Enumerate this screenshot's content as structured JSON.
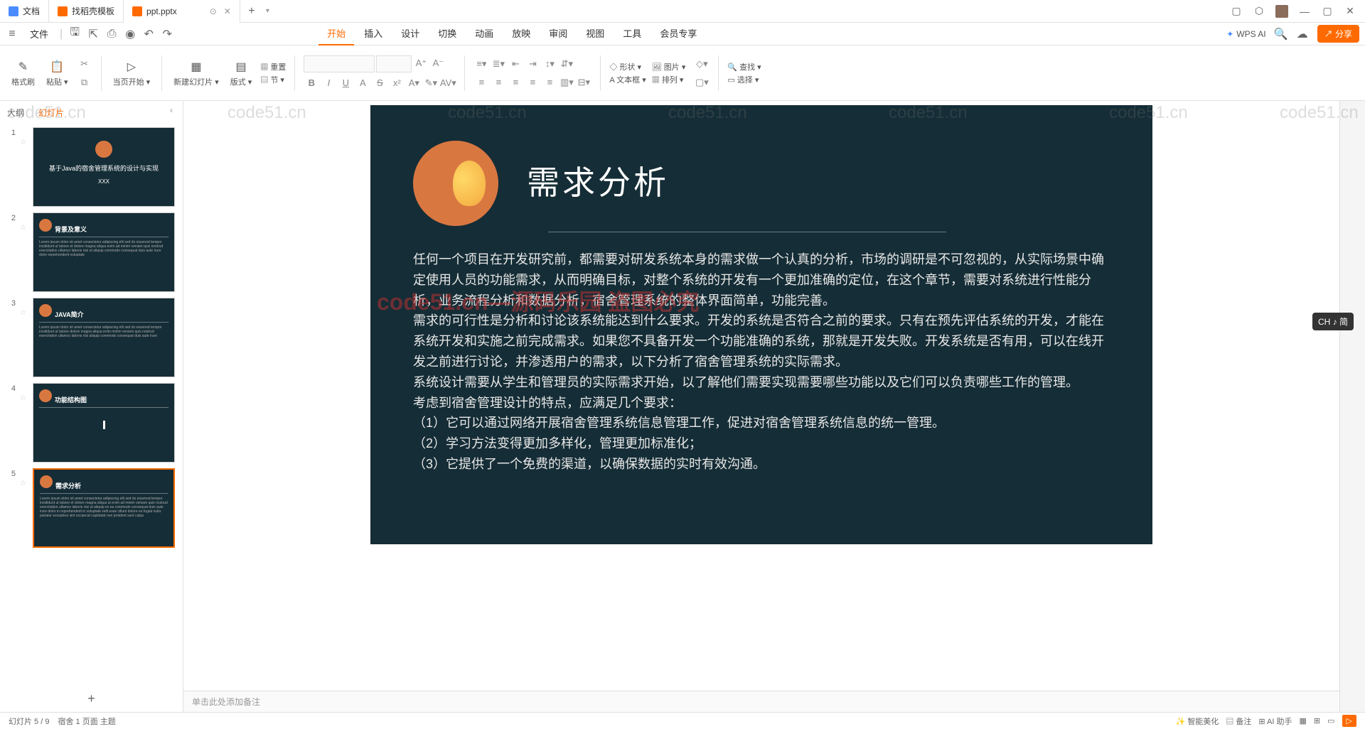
{
  "tabs": [
    {
      "label": "文档",
      "icon_color": "#4a8cff"
    },
    {
      "label": "找稻壳模板",
      "icon_color": "#ff6a00"
    },
    {
      "label": "ppt.pptx",
      "icon_color": "#ff6a00"
    }
  ],
  "menu": {
    "hamburger": "≡",
    "file": "文件",
    "tabs": [
      "开始",
      "插入",
      "设计",
      "切换",
      "动画",
      "放映",
      "审阅",
      "视图",
      "工具",
      "会员专享"
    ],
    "wps_ai": "WPS AI",
    "share": "分享"
  },
  "ribbon": {
    "format_painter": "格式刷",
    "paste": "粘贴",
    "start_from": "当页开始",
    "new_slide": "新建幻灯片",
    "layout": "版式",
    "section": "节",
    "reset": "重置",
    "shape": "形状",
    "image": "图片",
    "textbox": "文本框",
    "arrange": "排列",
    "find": "查找",
    "select": "选择"
  },
  "sidebar": {
    "outline_tab": "大纲",
    "slides_tab": "幻灯片",
    "slides": [
      {
        "num": "1",
        "title": "基于Java的宿舍管理系统的设计与实现",
        "sub": "XXX"
      },
      {
        "num": "2",
        "title": "背景及意义"
      },
      {
        "num": "3",
        "title": "JAVA简介"
      },
      {
        "num": "4",
        "title": "功能结构图"
      },
      {
        "num": "5",
        "title": "需求分析"
      }
    ]
  },
  "slide": {
    "title": "需求分析",
    "body": "任何一个项目在开发研究前，都需要对研发系统本身的需求做一个认真的分析，市场的调研是不可忽视的，从实际场景中确定使用人员的功能需求，从而明确目标，对整个系统的开发有一个更加准确的定位，在这个章节，需要对系统进行性能分析，业务流程分析和数据分析，宿舍管理系统的整体界面简单，功能完善。\n需求的可行性是分析和讨论该系统能达到什么要求。开发的系统是否符合之前的要求。只有在预先评估系统的开发，才能在系统开发和实施之前完成需求。如果您不具备开发一个功能准确的系统，那就是开发失败。开发系统是否有用，可以在线开发之前进行讨论，并渗透用户的需求，以下分析了宿舍管理系统的实际需求。\n系统设计需要从学生和管理员的实际需求开始，以了解他们需要实现需要哪些功能以及它们可以负责哪些工作的管理。\n考虑到宿舍管理设计的特点，应满足几个要求：\n（1）它可以通过网络开展宿舍管理系统信息管理工作，促进对宿舍管理系统信息的统一管理。\n（2）学习方法变得更加多样化，管理更加标准化；\n（3）它提供了一个免费的渠道，以确保数据的实时有效沟通。"
  },
  "notes_placeholder": "单击此处添加备注",
  "status": {
    "slide_info": "幻灯片 5 / 9",
    "theme_info": "宿舍 1 页面   主题",
    "smart": "智能美化",
    "notes": "备注",
    "ai": "AI 助手"
  },
  "ime": "CH ♪ 简",
  "watermark_text": "code51.cn",
  "watermark_red": "code51.cn—源码乐园 盗图必究"
}
